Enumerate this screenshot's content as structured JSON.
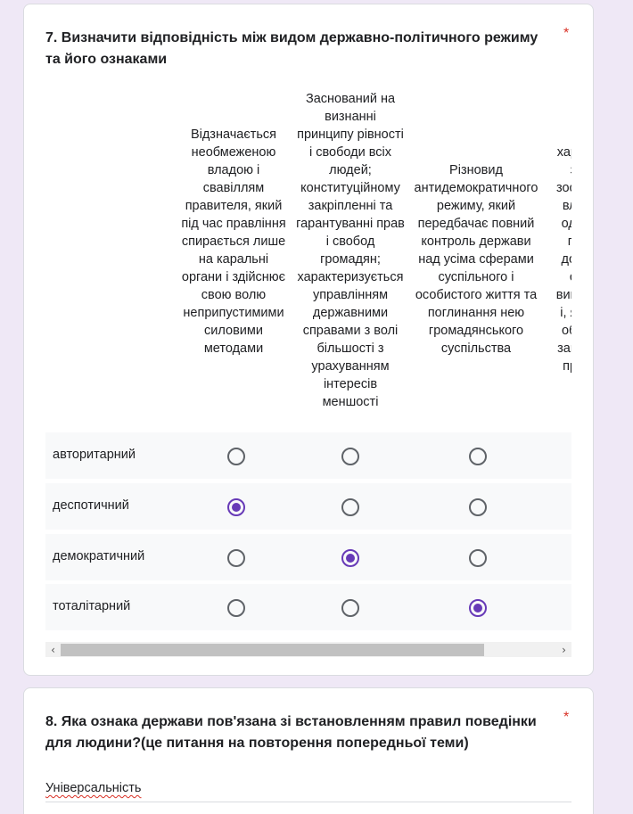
{
  "q7": {
    "title": "7. Визначити відповідність між видом державно-політичного режиму та його ознаками",
    "required_mark": "*",
    "columns": [
      "Відзначається необмеженою владою і свавіллям правителя, який під час правління спирається лише на каральні органи і здійснює свою волю неприпустимими силовими методами",
      "Заснований на визнанні принципу рівності і свободи всіх людей; конституційному закріпленні та гарантуванні прав і свобод громадян; характеризується управлінням державними справами з волі більшості з урахуванням інтересів меншості",
      "Різновид антидемократичного режиму, який передбачає повний контроль держави над усіма сферами суспільного і особистого життя та поглинання нею громадянського суспільства",
      "характ... зн... зосере... влад... однієї... гру... доміна... ор... викона... і, як н... обме... загаль... прав..."
    ],
    "column4_visible_lines": [
      "характ",
      "зн",
      "зосере",
      "влад",
      "одніє",
      "гру",
      "доміг",
      "ор",
      "викона",
      "і, як н",
      "обме",
      "загаль",
      "прав"
    ],
    "rows": [
      {
        "label": "авторитарний",
        "selected": null
      },
      {
        "label": "деспотичний",
        "selected": 0
      },
      {
        "label": "демократичний",
        "selected": 1
      },
      {
        "label": "тоталітарний",
        "selected": 2
      }
    ],
    "scroll_left": "‹",
    "scroll_right": "›"
  },
  "q8": {
    "title": "8. Яка ознака держави пов'язана зі встановленням правил поведінки для людини?(це питання на повторення попередньої теми)",
    "required_mark": "*",
    "answer": "Універсальність"
  },
  "colors": {
    "accent": "#673ab7",
    "required": "#d93025",
    "background": "#efe8f6"
  }
}
